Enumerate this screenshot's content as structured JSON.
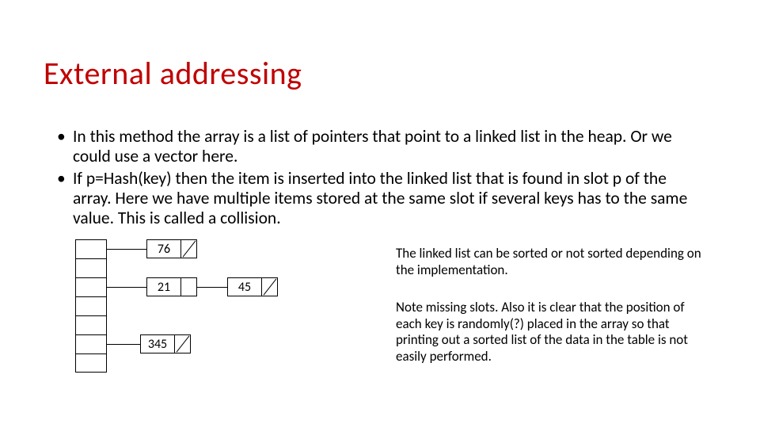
{
  "title": "External addressing",
  "bullets": [
    "In this method the array is a list of pointers that point to a linked list in the heap. Or we could use a vector here.",
    "If p=Hash(key) then the item is inserted into the linked list that is found in slot p of the array.  Here we have multiple items stored at the same slot if several keys has to the same value.  This is called a collision."
  ],
  "diagram": {
    "slots": 7,
    "rows": [
      {
        "slot": 0,
        "nodes": [
          "76"
        ]
      },
      {
        "slot": 2,
        "nodes": [
          "21",
          "45"
        ]
      },
      {
        "slot": 5,
        "nodes": [
          "345"
        ]
      }
    ]
  },
  "notes": [
    "The linked list can be sorted or not sorted depending on the implementation.",
    "Note missing slots.  Also it is clear that the position of each key is randomly(?) placed in the array so that printing out a sorted list of the data in the table is not easily performed."
  ],
  "colors": {
    "title": "#c00000"
  }
}
